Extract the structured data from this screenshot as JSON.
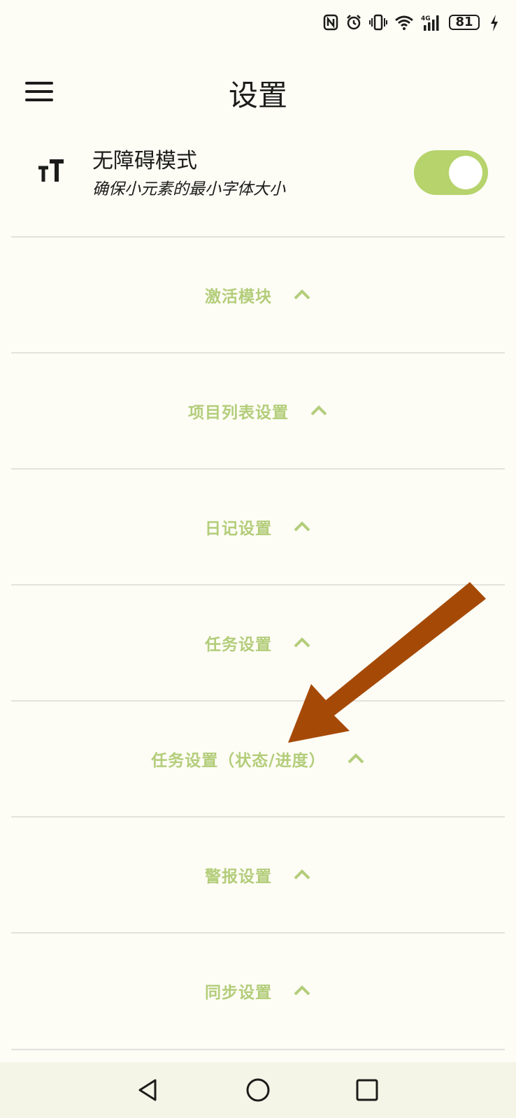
{
  "status_bar": {
    "battery_level": "81",
    "network": "4G",
    "icons": [
      "nfc-icon",
      "alarm-icon",
      "vibrate-icon",
      "wifi-icon",
      "signal-icon",
      "battery-icon",
      "charging-icon"
    ]
  },
  "header": {
    "title": "设置",
    "menu_icon": "hamburger-menu-icon"
  },
  "accessibility": {
    "title": "无障碍模式",
    "subtitle": "确保小元素的最小字体大小",
    "icon": "text-size-icon",
    "toggle_on": true
  },
  "sections": [
    {
      "label": "激活模块"
    },
    {
      "label": "项目列表设置"
    },
    {
      "label": "日记设置"
    },
    {
      "label": "任务设置"
    },
    {
      "label": "任务设置（状态/进度）"
    },
    {
      "label": "警报设置"
    },
    {
      "label": "同步设置"
    }
  ],
  "nav_bar": {
    "icons": [
      "back-icon",
      "home-icon",
      "recents-icon"
    ]
  },
  "colors": {
    "background": "#fdfcf5",
    "accent": "#b3cd7a",
    "toggle": "#b6d36c",
    "annotation_arrow": "#a54a06"
  }
}
